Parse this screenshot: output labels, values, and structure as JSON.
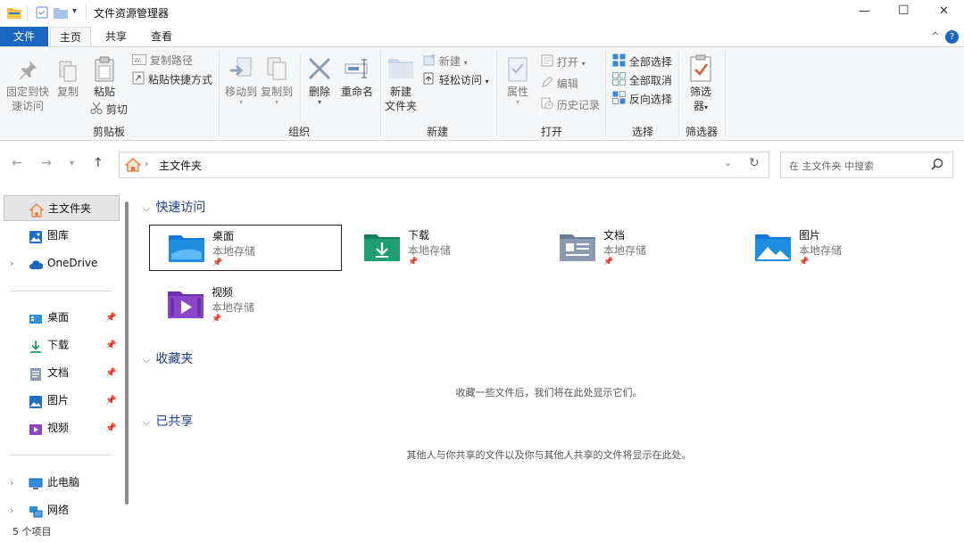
{
  "window": {
    "title": "文件资源管理器",
    "controls": {
      "minimize": "—",
      "maximize": "☐",
      "close": "✕"
    }
  },
  "menu": {
    "tabs": [
      "文件",
      "主页",
      "共享",
      "查看"
    ],
    "active": "主页",
    "collapse_glyph": "^",
    "help_glyph": "?"
  },
  "ribbon": {
    "clipboard": {
      "pin_label_1": "固定到快",
      "pin_label_2": "速访问",
      "copy": "复制",
      "paste": "粘贴",
      "copy_path": "复制路径",
      "paste_shortcut": "粘贴快捷方式",
      "cut": "剪切",
      "group": "剪贴板"
    },
    "organize": {
      "move_to": "移动到",
      "copy_to": "复制到",
      "delete": "删除",
      "rename": "重命名",
      "group": "组织"
    },
    "new": {
      "new_folder_1": "新建",
      "new_folder_2": "文件夹",
      "new_item": "新建",
      "easy_access": "轻松访问",
      "group": "新建"
    },
    "open": {
      "properties": "属性",
      "open": "打开",
      "edit": "编辑",
      "history": "历史记录",
      "group": "打开"
    },
    "select": {
      "select_all": "全部选择",
      "select_none": "全部取消",
      "invert": "反向选择",
      "group": "选择"
    },
    "filter": {
      "label_1": "筛选",
      "label_2": "器",
      "group": "筛选器"
    }
  },
  "address": {
    "breadcrumb": "主文件夹",
    "search_placeholder": "在 主文件夹 中搜索"
  },
  "sidebar": {
    "home": "主文件夹",
    "gallery": "图库",
    "onedrive": "OneDrive",
    "pinned": [
      {
        "label": "桌面"
      },
      {
        "label": "下载"
      },
      {
        "label": "文档"
      },
      {
        "label": "图片"
      },
      {
        "label": "视频"
      }
    ],
    "this_pc": "此电脑",
    "network": "网络"
  },
  "content": {
    "quick_access": "快速访问",
    "favorites": "收藏夹",
    "shared": "已共享",
    "tiles": [
      {
        "name": "桌面",
        "sub": "本地存储"
      },
      {
        "name": "下载",
        "sub": "本地存储"
      },
      {
        "name": "文档",
        "sub": "本地存储"
      },
      {
        "name": "图片",
        "sub": "本地存储"
      },
      {
        "name": "视频",
        "sub": "本地存储"
      }
    ],
    "favorites_empty": "收藏一些文件后，我们将在此处显示它们。",
    "shared_empty": "其他人与你共享的文件以及你与其他人共享的文件将显示在此处。"
  },
  "status": {
    "count": "5 个项目"
  },
  "colors": {
    "accent": "#1a66c2",
    "folder_blue": "#1e8fe0",
    "download_green": "#1f9e73",
    "video_purple": "#8b45c9"
  }
}
